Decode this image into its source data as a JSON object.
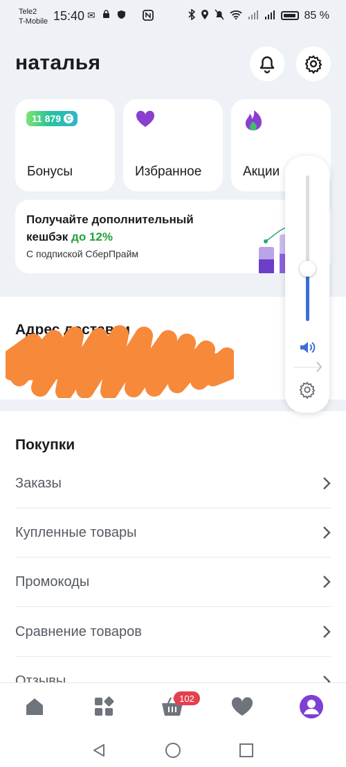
{
  "status_bar": {
    "carrier_1": "Tele2",
    "carrier_2": "T-Mobile",
    "time": "15:40",
    "battery": "85 %"
  },
  "header": {
    "username": "наталья"
  },
  "cards": {
    "bonus_amount": "11 879",
    "bonus_label": "Бонусы",
    "favorites_label": "Избранное",
    "promos_label": "Акции"
  },
  "promo": {
    "line1": "Получайте дополнительный",
    "line2_prefix": "кешбэк ",
    "line2_highlight": "до 12%",
    "subtitle": "С подпиской СберПрайм"
  },
  "address": {
    "title": "Адрес доставки"
  },
  "purchases": {
    "title": "Покупки",
    "items": [
      {
        "label": "Заказы"
      },
      {
        "label": "Купленные товары"
      },
      {
        "label": "Промокоды"
      },
      {
        "label": "Сравнение товаров"
      },
      {
        "label": "Отзывы"
      }
    ]
  },
  "volume": {
    "level": 0.36
  },
  "bottom_nav": {
    "cart_count": "102"
  },
  "colors": {
    "accent_purple": "#7d3fd4",
    "green": "#21a038",
    "volume_blue": "#3b6fd8",
    "badge_red": "#e4414f",
    "redaction_orange": "#f7893b"
  }
}
